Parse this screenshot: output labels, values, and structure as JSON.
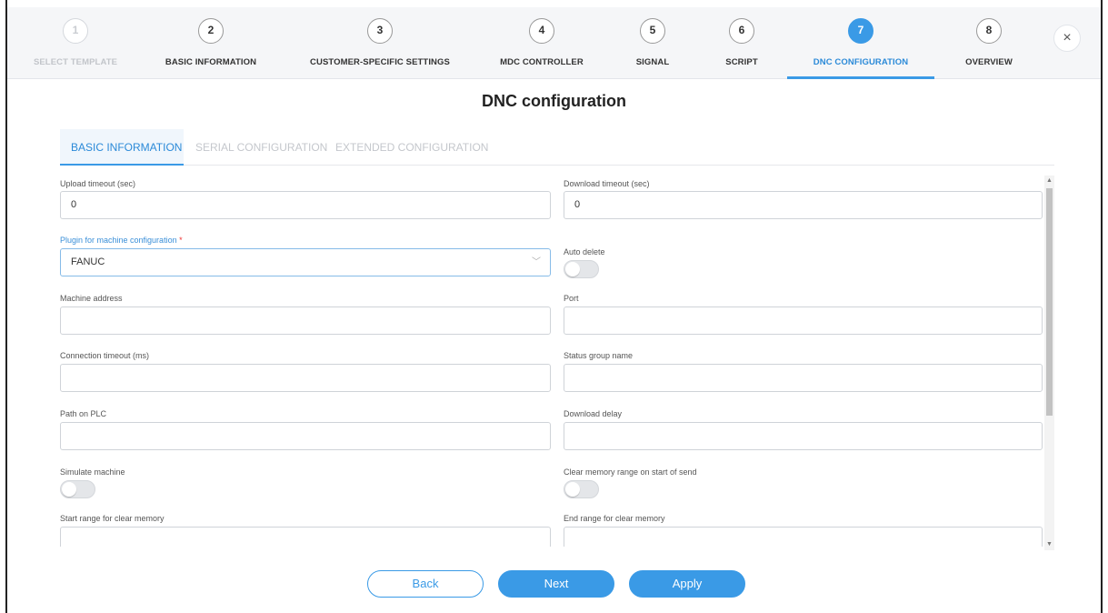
{
  "stepper": {
    "steps": [
      {
        "number": "1",
        "label": "SELECT TEMPLATE",
        "state": "disabled"
      },
      {
        "number": "2",
        "label": "BASIC INFORMATION",
        "state": "done"
      },
      {
        "number": "3",
        "label": "CUSTOMER-SPECIFIC SETTINGS",
        "state": "done"
      },
      {
        "number": "4",
        "label": "MDC CONTROLLER",
        "state": "done"
      },
      {
        "number": "5",
        "label": "SIGNAL",
        "state": "done"
      },
      {
        "number": "6",
        "label": "SCRIPT",
        "state": "done"
      },
      {
        "number": "7",
        "label": "DNC CONFIGURATION",
        "state": "active"
      },
      {
        "number": "8",
        "label": "OVERVIEW",
        "state": "pending"
      }
    ],
    "close_symbol": "×"
  },
  "page": {
    "title": "DNC configuration"
  },
  "tabs": [
    {
      "label": "BASIC INFORMATION",
      "active": true
    },
    {
      "label": "SERIAL CONFIGURATION",
      "active": false
    },
    {
      "label": "EXTENDED CONFIGURATION",
      "active": false
    }
  ],
  "form": {
    "upload_timeout": {
      "label": "Upload timeout (sec)",
      "value": "0"
    },
    "download_timeout": {
      "label": "Download timeout (sec)",
      "value": "0"
    },
    "plugin": {
      "label": "Plugin for machine configuration",
      "required_mark": "*",
      "value": "FANUC",
      "arrow": "﹀"
    },
    "auto_delete": {
      "label": "Auto delete",
      "on": false
    },
    "machine_address": {
      "label": "Machine address",
      "value": ""
    },
    "port": {
      "label": "Port",
      "value": ""
    },
    "connection_timeout": {
      "label": "Connection timeout (ms)",
      "value": ""
    },
    "status_group_name": {
      "label": "Status group name",
      "value": ""
    },
    "path_on_plc": {
      "label": "Path on PLC",
      "value": ""
    },
    "download_delay": {
      "label": "Download delay",
      "value": ""
    },
    "simulate_machine": {
      "label": "Simulate machine",
      "on": false
    },
    "clear_memory": {
      "label": "Clear memory range on start of send",
      "on": false
    },
    "start_range": {
      "label": "Start range for clear memory",
      "value": ""
    },
    "end_range": {
      "label": "End range for clear memory",
      "value": ""
    }
  },
  "buttons": {
    "back": "Back",
    "next": "Next",
    "apply": "Apply"
  },
  "colors": {
    "accent": "#3a9ae6",
    "required": "#e33333"
  }
}
